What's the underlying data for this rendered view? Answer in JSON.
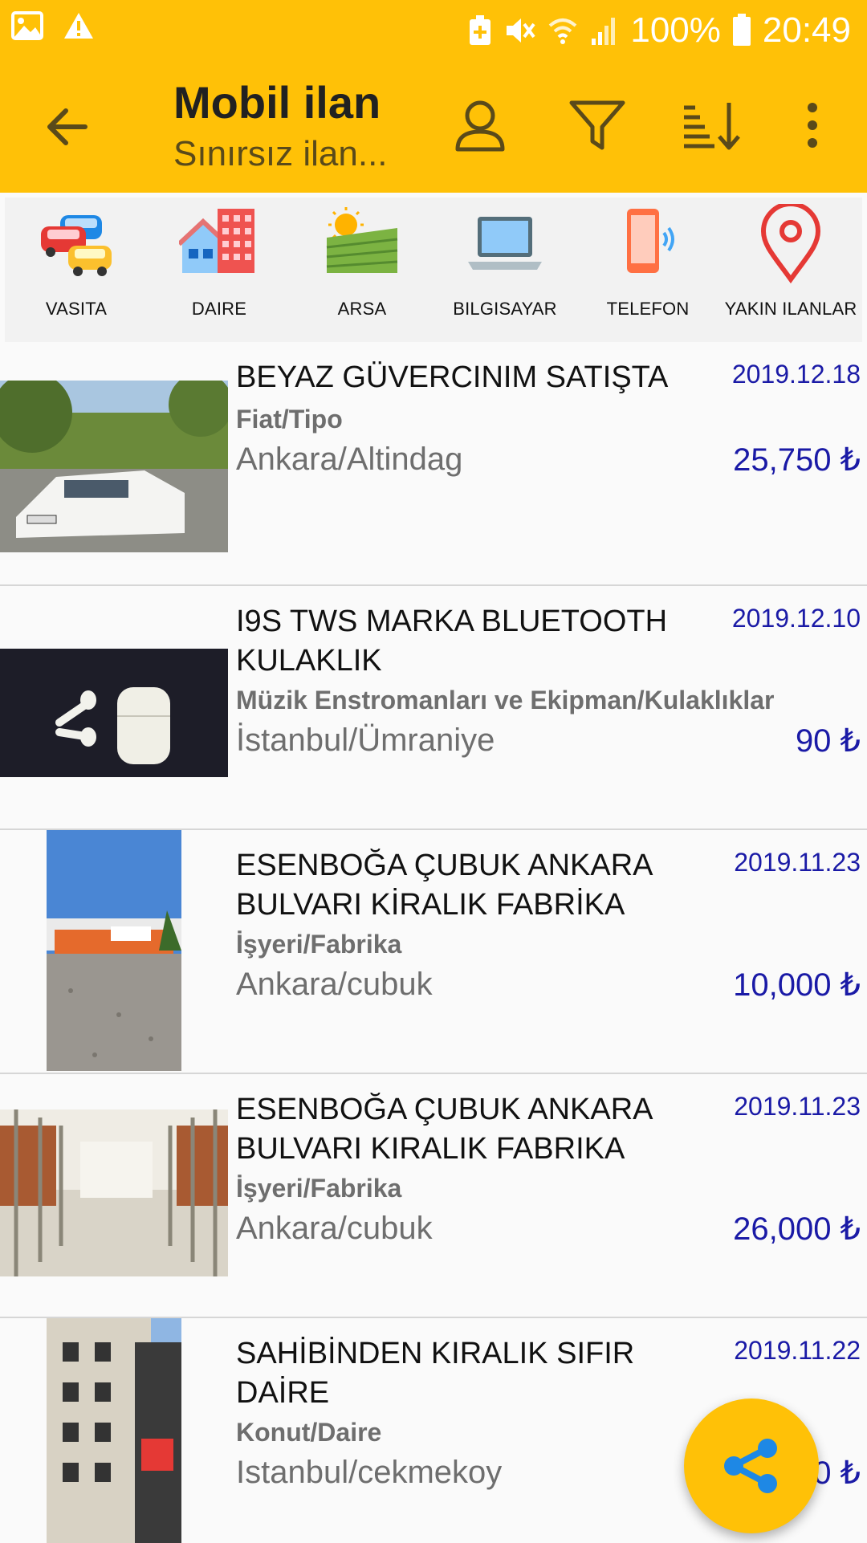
{
  "status_bar": {
    "battery": "100%",
    "time": "20:49"
  },
  "app_bar": {
    "title": "Mobil ilan",
    "subtitle": "Sınırsız ilan..."
  },
  "categories": [
    {
      "label": "VASITA",
      "icon": "cars-icon"
    },
    {
      "label": "DAIRE",
      "icon": "buildings-icon"
    },
    {
      "label": "ARSA",
      "icon": "field-icon"
    },
    {
      "label": "BILGISAYAR",
      "icon": "laptop-icon"
    },
    {
      "label": "TELEFON",
      "icon": "phone-icon"
    },
    {
      "label": "YAKIN ILANLAR",
      "icon": "location-pin-icon"
    }
  ],
  "listings": [
    {
      "title": "BEYAZ GÜVERCINIM SATIŞTA",
      "date": "2019.12.18",
      "category": "Fiat/Tipo",
      "location": "Ankara/Altindag",
      "price": "25,750 ₺",
      "image": "white-car-photo"
    },
    {
      "title": "I9S TWS MARKA BLUETOOTH KULAKLIK",
      "date": "2019.12.10",
      "category": "Müzik Enstromanları ve Ekipman/Kulaklıklar",
      "location": "İstanbul/Ümraniye",
      "price": "90 ₺",
      "image": "earbuds-photo"
    },
    {
      "title": "ESENBOĞA ÇUBUK ANKARA BULVARI KİRALIK FABRİKA",
      "date": "2019.11.23",
      "category": "İşyeri/Fabrika",
      "location": "Ankara/cubuk",
      "price": "10,000 ₺",
      "image": "factory-exterior-photo"
    },
    {
      "title": "ESENBOĞA ÇUBUK ANKARA BULVARI KIRALIK FABRIKA",
      "date": "2019.11.23",
      "category": "İşyeri/Fabrika",
      "location": "Ankara/cubuk",
      "price": "26,000 ₺",
      "image": "factory-interior-photo"
    },
    {
      "title": "SAHİBİNDEN KIRALIK SIFIR DAİRE",
      "date": "2019.11.22",
      "category": "Konut/Daire",
      "location": "Istanbul/cekmekoy",
      "price": "0 ₺",
      "image": "apartment-building-photo"
    }
  ],
  "colors": {
    "accent": "#FFC107",
    "price_blue": "#1a1aa6",
    "share_icon": "#1E88E5"
  }
}
